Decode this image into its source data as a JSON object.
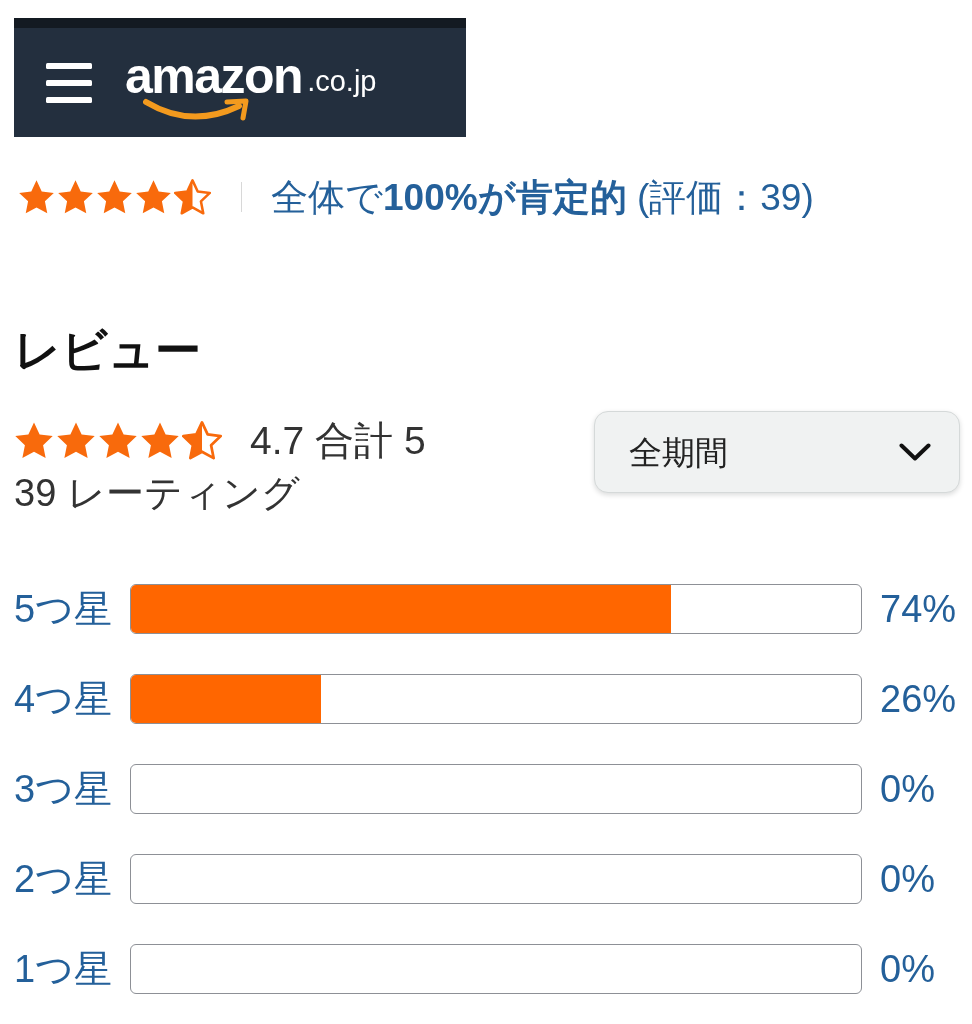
{
  "header": {
    "logo": {
      "wordmark": "amazon",
      "domain": ".co.jp"
    }
  },
  "summary": {
    "stars": 4.5,
    "text": "全体で**100%が肯定的** (評価：39)"
  },
  "reviews": {
    "title": "レビュー",
    "stars": 4.5,
    "average": "4.7 合計 5",
    "rating_count": "39 レーティング",
    "period": {
      "value": "全期間"
    },
    "histogram": [
      {
        "label": "5つ星",
        "level": 0.74,
        "percent": "74%"
      },
      {
        "label": "4つ星",
        "level": 0.26,
        "percent": "26%"
      },
      {
        "label": "3つ星",
        "level": 0,
        "percent": "0%"
      },
      {
        "label": "2つ星",
        "level": 0,
        "percent": "0%"
      },
      {
        "label": "1つ星",
        "level": 0,
        "percent": "0%"
      }
    ]
  }
}
